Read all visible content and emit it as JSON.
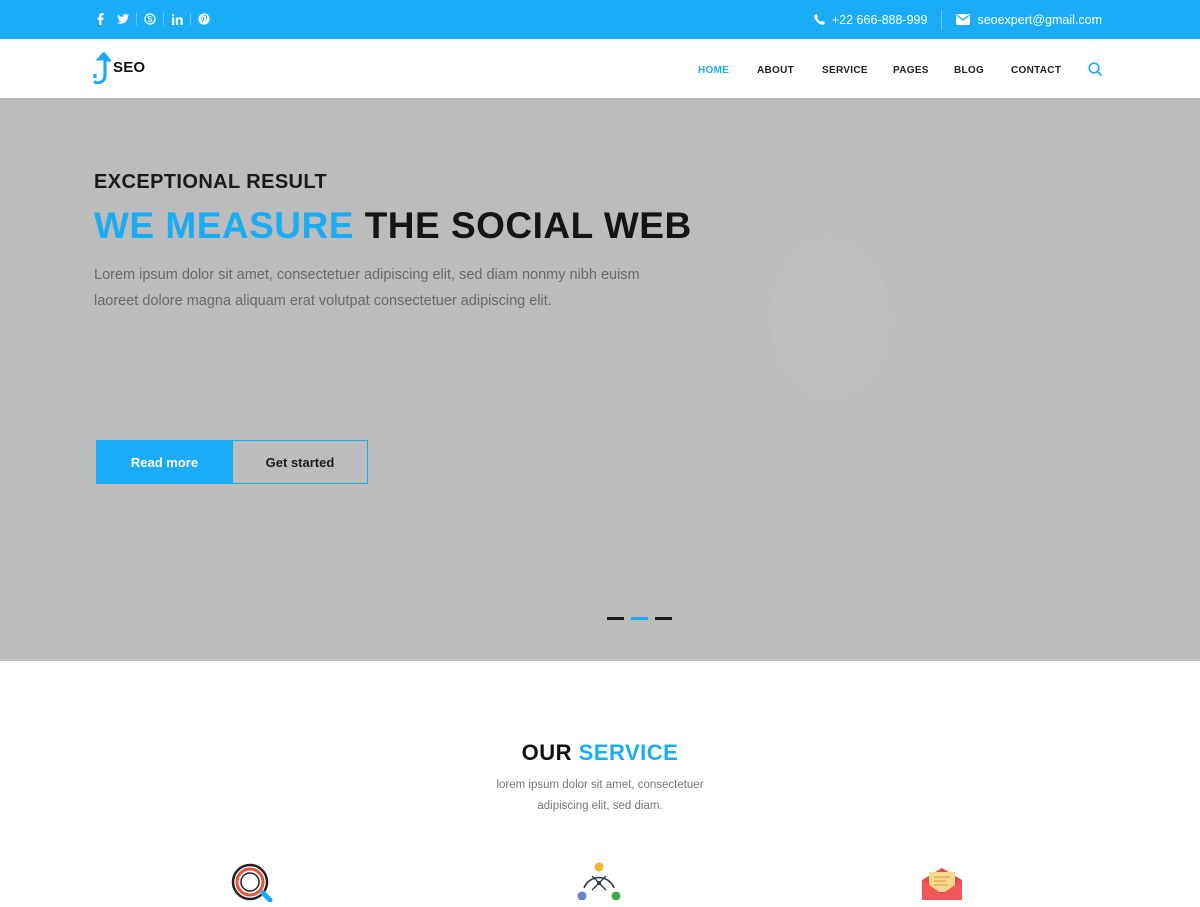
{
  "topbar": {
    "social": [
      {
        "name": "facebook-icon",
        "glyph": "f"
      },
      {
        "name": "twitter-icon",
        "glyph": "t"
      },
      {
        "name": "skype-icon",
        "glyph": "S"
      },
      {
        "name": "linkedin-icon",
        "glyph": "in"
      },
      {
        "name": "pinterest-icon",
        "glyph": "p"
      }
    ],
    "phone": "+22 666-888-999",
    "email": "seoexpert@gmail.com"
  },
  "brand": {
    "name": "SEO",
    "accent": "#1aacf6"
  },
  "nav": {
    "items": [
      {
        "label": "HOME",
        "active": true
      },
      {
        "label": "ABOUT"
      },
      {
        "label": "SERVICE"
      },
      {
        "label": "PAGES"
      },
      {
        "label": "BLOG"
      },
      {
        "label": "CONTACT"
      }
    ],
    "search_icon": "search-icon"
  },
  "hero": {
    "kicker": "EXCEPTIONAL RESULT",
    "headline_accent": "WE MEASURE",
    "headline_rest": "THE SOCIAL WEB",
    "text_line1": "Lorem ipsum dolor sit amet, consectetuer adipiscing elit, sed diam nonmy nibh euism",
    "text_line2": "laoreet dolore magna aliquam erat volutpat consectetuer adipiscing elit.",
    "primary_button": "Read more",
    "secondary_button": "Get started",
    "slides": 3,
    "active_slide": 2
  },
  "service": {
    "title_dark": "OUR",
    "title_accent": "SERVICE",
    "subtitle_line1": "lorem ipsum dolor sit amet, consectetuer",
    "subtitle_line2": "adipiscing elit, sed diam.",
    "icons": [
      "magnifier-icon",
      "network-icon",
      "envelope-icon"
    ]
  }
}
